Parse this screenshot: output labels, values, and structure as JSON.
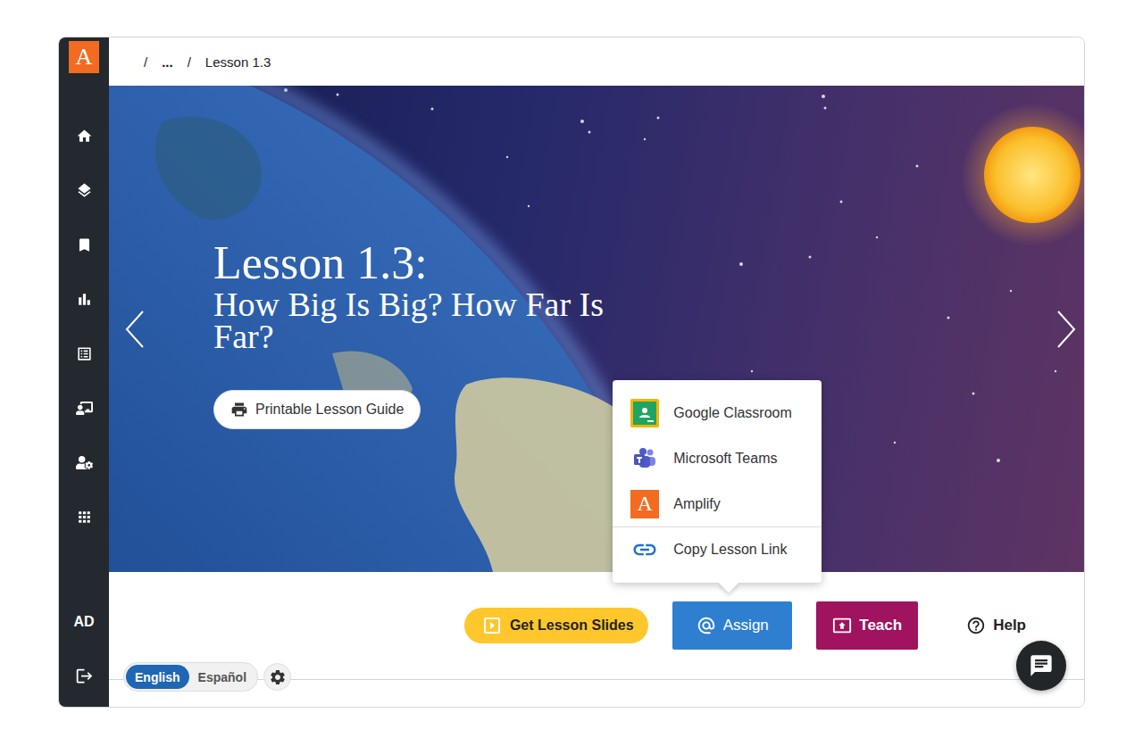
{
  "sidebar": {
    "logo": "A",
    "user": "AD"
  },
  "breadcrumb": {
    "separator": "/",
    "items": [
      "...",
      "Lesson 1.3"
    ]
  },
  "hero": {
    "title": "Lesson 1.3:",
    "subtitle": "How Big Is Big? How Far Is Far?",
    "guide_button": "Printable Lesson Guide"
  },
  "actions": [
    {
      "label": "Get Lesson Slides",
      "kind": "slides"
    },
    {
      "label": "Assign",
      "kind": "assign"
    },
    {
      "label": "Teach",
      "kind": "teach"
    },
    {
      "label": "Help",
      "kind": "help"
    }
  ],
  "assign_menu": {
    "open": true,
    "items": [
      {
        "label": "Google Classroom",
        "kind": "classroom"
      },
      {
        "label": "Microsoft Teams",
        "kind": "teams"
      },
      {
        "label": "Amplify",
        "kind": "amplify",
        "badge": "A"
      },
      {
        "label": "Copy Lesson Link",
        "kind": "link"
      }
    ]
  },
  "language": [
    {
      "label": "English",
      "selected": true
    },
    {
      "label": "Español",
      "selected": false
    }
  ]
}
